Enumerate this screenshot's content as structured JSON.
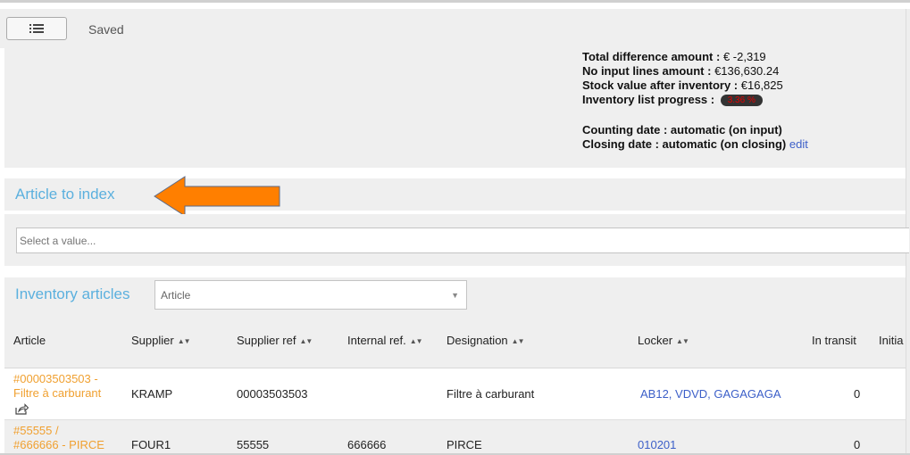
{
  "toolbar": {
    "menu_icon": "list-icon",
    "saved": "Saved"
  },
  "summary": {
    "total_difference_label": "Total difference amount :",
    "total_difference_value": "€ -2,319",
    "no_input_label": "No input lines amount :",
    "no_input_value": "€136,630.24",
    "stock_value_label": "Stock value after inventory :",
    "stock_value_value": "€16,825",
    "progress_label": "Inventory list progress :",
    "progress_value": "3.36 %",
    "progress_color": "#e60000",
    "counting_date": "Counting date : automatic (on input)",
    "closing_date": "Closing date : automatic (on closing)",
    "edit": "edit"
  },
  "article_to_index": {
    "title": "Article to index",
    "placeholder": "Select a value...",
    "arrow_color": "#ff7f00"
  },
  "inventory": {
    "title": "Inventory articles",
    "filter_placeholder": "Article",
    "columns": [
      "Article",
      "Supplier",
      "Supplier ref",
      "Internal ref.",
      "Designation",
      "Locker",
      "In transit",
      "Initia"
    ],
    "rows": [
      {
        "article_line1": "#00003503503 -",
        "article_line2": "Filtre à carburant",
        "supplier": "KRAMP",
        "supplier_ref": "00003503503",
        "internal_ref": "",
        "designation": "Filtre à carburant",
        "locker": "AB12,  VDVD, GAGAGAGA",
        "in_transit": "0",
        "share_icon": "share-icon"
      },
      {
        "article_line1": "#55555 /",
        "article_line2": "#666666 - PIRCE",
        "supplier": "FOUR1",
        "supplier_ref": "55555",
        "internal_ref": "666666",
        "designation": "PIRCE",
        "locker": "010201",
        "in_transit": "0"
      }
    ]
  },
  "colors": {
    "section_title": "#5bb0de",
    "link": "#3c5fc8",
    "article_link": "#f0a030"
  }
}
